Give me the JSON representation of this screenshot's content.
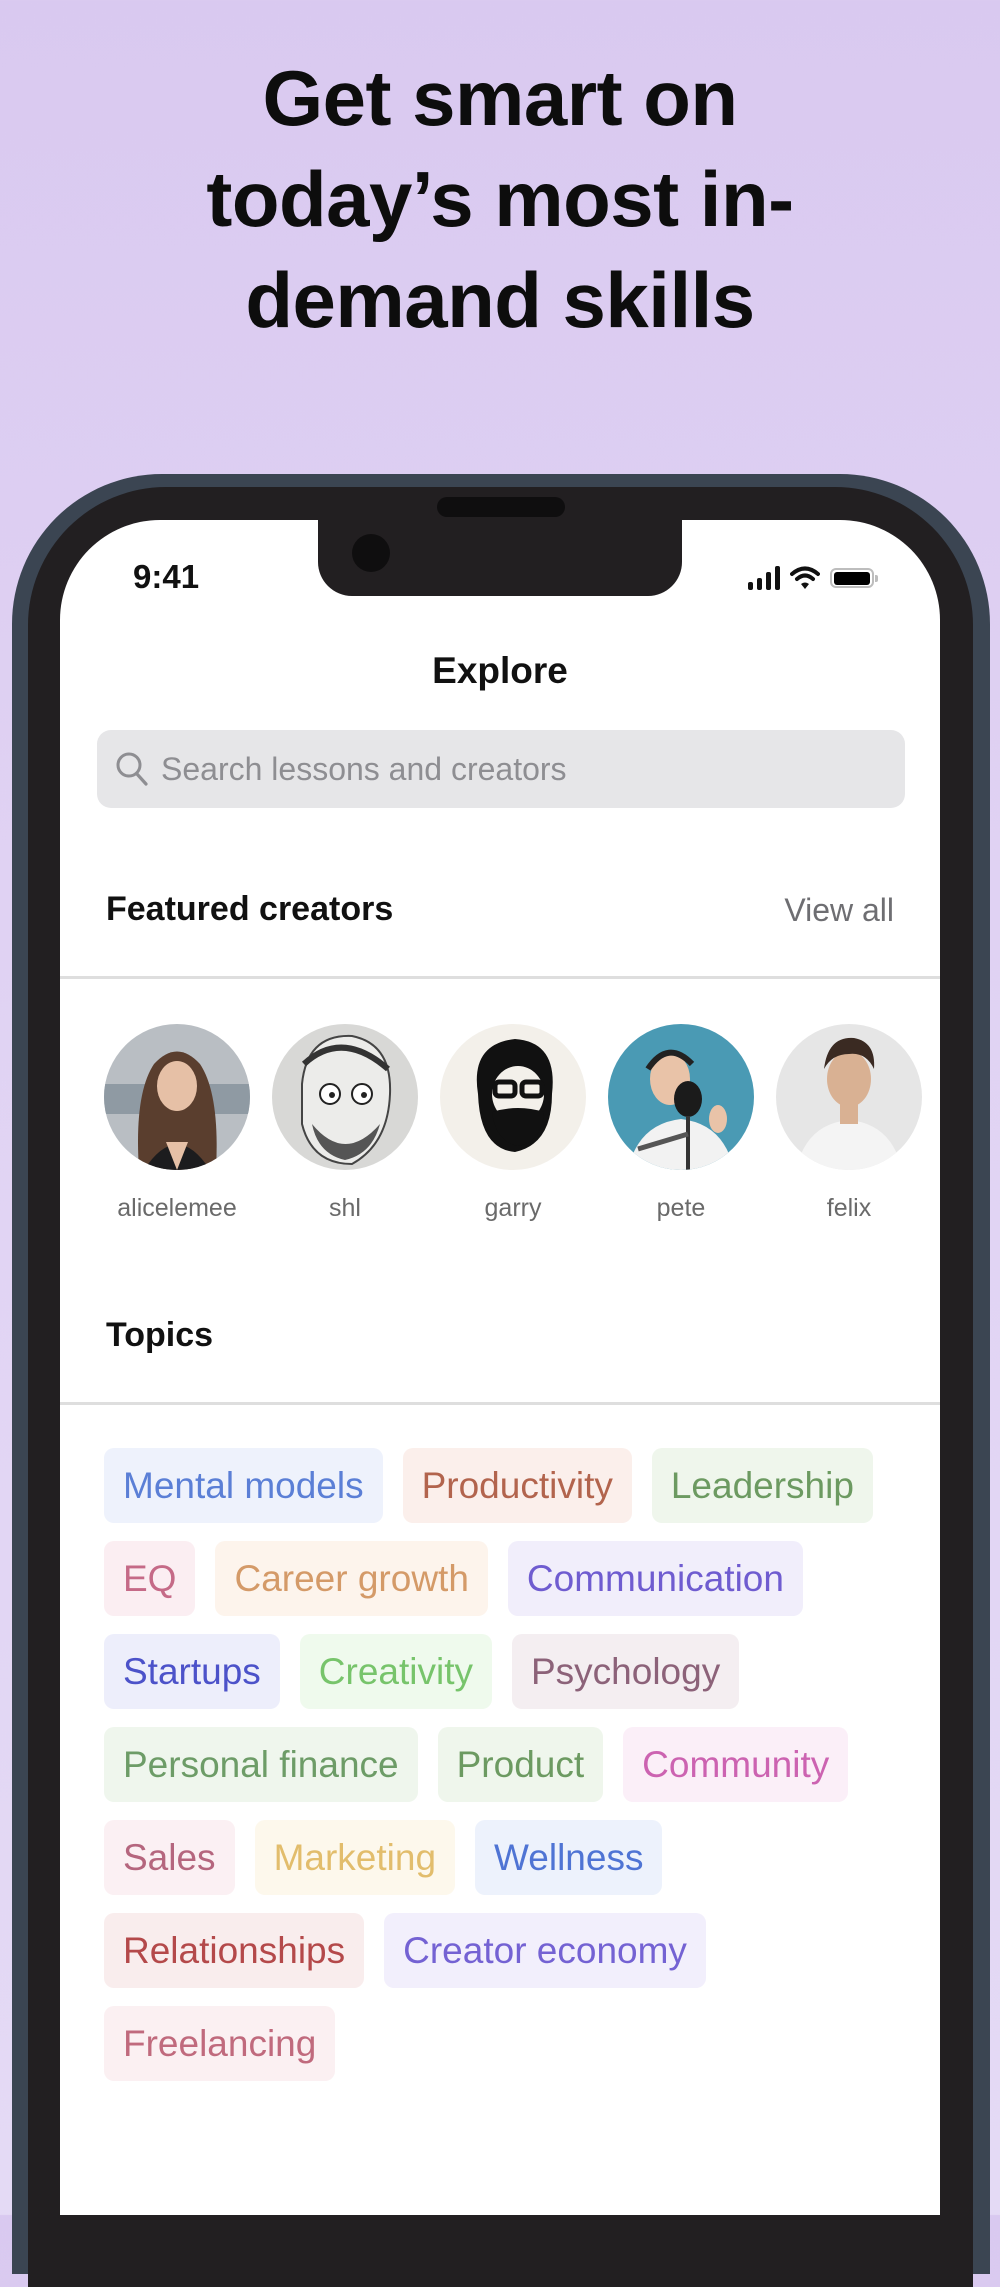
{
  "headline": {
    "lines": [
      "Get smart on",
      "today’s most in-",
      "demand skills"
    ]
  },
  "status_bar": {
    "time": "9:41",
    "icons": [
      "cellular-signal-icon",
      "wifi-icon",
      "battery-icon"
    ]
  },
  "header": {
    "title": "Explore"
  },
  "search": {
    "placeholder": "Search lessons and creators",
    "value": "",
    "icon": "search-icon"
  },
  "featured_creators": {
    "title": "Featured creators",
    "view_all_label": "View all",
    "creators": [
      {
        "name": "alicelemee"
      },
      {
        "name": "shl"
      },
      {
        "name": "garry"
      },
      {
        "name": "pete"
      },
      {
        "name": "felix"
      }
    ]
  },
  "topics": {
    "title": "Topics",
    "items": [
      {
        "label": "Mental models",
        "color": "#5b7fd6",
        "bg": "#eef2fc"
      },
      {
        "label": "Productivity",
        "color": "#b2644d",
        "bg": "#fbefeb"
      },
      {
        "label": "Leadership",
        "color": "#6c9a61",
        "bg": "#eff6ec"
      },
      {
        "label": "EQ",
        "color": "#c56a87",
        "bg": "#fbeef2"
      },
      {
        "label": "Career growth",
        "color": "#d49a68",
        "bg": "#fdf4ec"
      },
      {
        "label": "Communication",
        "color": "#6f5cd0",
        "bg": "#f1eefb"
      },
      {
        "label": "Startups",
        "color": "#4c52c9",
        "bg": "#edeefb"
      },
      {
        "label": "Creativity",
        "color": "#77c46b",
        "bg": "#effaed"
      },
      {
        "label": "Psychology",
        "color": "#8c6279",
        "bg": "#f4eef1"
      },
      {
        "label": "Personal finance",
        "color": "#6d9c67",
        "bg": "#eff6ed"
      },
      {
        "label": "Product",
        "color": "#6c9a61",
        "bg": "#eff6ec"
      },
      {
        "label": "Community",
        "color": "#cc63b1",
        "bg": "#fbeff8"
      },
      {
        "label": "Sales",
        "color": "#b5667e",
        "bg": "#fbf0f3"
      },
      {
        "label": "Marketing",
        "color": "#e2bd6c",
        "bg": "#fdf8ec"
      },
      {
        "label": "Wellness",
        "color": "#4f74d4",
        "bg": "#edf2fc"
      },
      {
        "label": "Relationships",
        "color": "#b4494a",
        "bg": "#f9eded"
      },
      {
        "label": "Creator economy",
        "color": "#7462d3",
        "bg": "#f2effc"
      },
      {
        "label": "Freelancing",
        "color": "#c06a7d",
        "bg": "#fbf0f2"
      }
    ]
  },
  "colors": {
    "background": "#ddcdf2",
    "frame_outer": "#3b4552",
    "frame_inner": "#221f21",
    "screen": "#ffffff"
  }
}
